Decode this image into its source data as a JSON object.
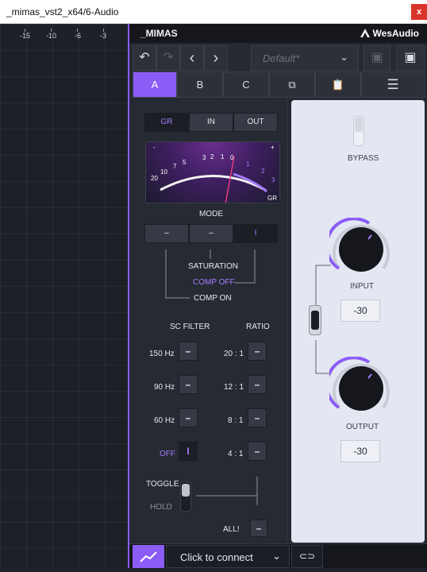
{
  "window": {
    "title": "_mimas_vst2_x64/6-Audio",
    "close_label": "x"
  },
  "ruler": {
    "ticks": [
      "-15",
      "-10",
      "-6",
      "-3"
    ]
  },
  "plugin": {
    "name": "_MIMAS",
    "brand": "WesAudio",
    "toolbar": {
      "undo": "↶",
      "redo": "↷",
      "prev": "‹",
      "next": "›",
      "preset": "Default*",
      "preset_chevron": "⌄",
      "save": "▣",
      "save_as": "▣"
    },
    "tabs": [
      "A",
      "B",
      "C"
    ],
    "tab_icons": {
      "copy": "⧉",
      "paste": "📋",
      "menu": "☰"
    },
    "meter_source": [
      "GR",
      "IN",
      "OUT"
    ],
    "meter": {
      "scale_left": [
        "20",
        "10",
        "7",
        "5",
        "3",
        "2",
        "1",
        "0"
      ],
      "scale_right": [
        "1",
        "2",
        "3"
      ],
      "minus": "-",
      "plus": "+",
      "gr_label": "GR"
    },
    "mode": {
      "title": "MODE",
      "buttons": [
        "–",
        "–",
        "I"
      ],
      "options": [
        "SATURATION",
        "COMP OFF",
        "COMP ON"
      ]
    },
    "sc_filter": {
      "title": "SC FILTER",
      "values": [
        "150 Hz",
        "90 Hz",
        "60 Hz",
        "OFF"
      ],
      "buttons": [
        "–",
        "–",
        "–",
        "I"
      ]
    },
    "ratio": {
      "title": "RATIO",
      "values": [
        "20 : 1",
        "12 : 1",
        "8 : 1",
        "4 : 1"
      ],
      "buttons": [
        "–",
        "–",
        "–",
        "–"
      ]
    },
    "toggle": {
      "label": "TOGGLE",
      "hold": "HOLD",
      "all": "ALL!",
      "all_btn": "–"
    },
    "bypass": "BYPASS",
    "input": {
      "label": "INPUT",
      "value": "-30"
    },
    "output": {
      "label": "OUTPUT",
      "value": "-30"
    },
    "bottom": {
      "connect": "Click to connect",
      "chevron": "⌄",
      "link_icon": "⊂⊃"
    },
    "accent": "#8b5cf6"
  }
}
